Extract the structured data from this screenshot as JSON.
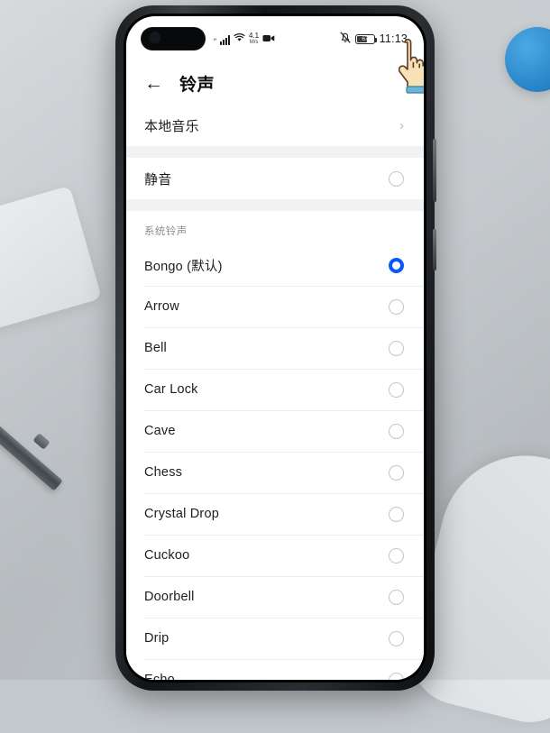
{
  "device": {
    "camera_cutout": "dual-punch-hole-camera",
    "side_buttons": [
      "volume-rocker",
      "power-button"
    ]
  },
  "statusbar": {
    "signal_prefix": "“",
    "signal_icon": "signal-bars-icon",
    "wifi_icon": "wifi-icon",
    "network_speed_value": "4.1",
    "network_speed_unit": "M/s",
    "recording_icon": "video-recording-icon",
    "mute_icon": "bell-off-icon",
    "battery_icon": "battery-icon",
    "battery_level": "67",
    "time": "11:13"
  },
  "header": {
    "back_icon": "←",
    "title": "铃声"
  },
  "list": {
    "local_group": [
      {
        "label": "本地音乐",
        "accessory": "chevron",
        "cjk": true
      }
    ],
    "silent_group": [
      {
        "label": "静音",
        "accessory": "radio",
        "selected": false,
        "cjk": true
      }
    ],
    "system_section_title": "系统铃声",
    "system_ringtones": [
      {
        "label": "Bongo (默认)",
        "selected": true
      },
      {
        "label": "Arrow",
        "selected": false
      },
      {
        "label": "Bell",
        "selected": false
      },
      {
        "label": "Car Lock",
        "selected": false
      },
      {
        "label": "Cave",
        "selected": false
      },
      {
        "label": "Chess",
        "selected": false
      },
      {
        "label": "Crystal Drop",
        "selected": false
      },
      {
        "label": "Cuckoo",
        "selected": false
      },
      {
        "label": "Doorbell",
        "selected": false
      },
      {
        "label": "Drip",
        "selected": false
      },
      {
        "label": "Echo",
        "selected": false
      }
    ]
  },
  "cursor": {
    "icon": "pointing-hand-cursor",
    "target_row": "Car Lock"
  },
  "colors": {
    "accent": "#0a59f7",
    "radio_unselected": "#c5c5c7",
    "separator": "#eceded",
    "group_gap": "#f1f2f3",
    "background": "#c3c8cc",
    "text_primary": "#1d1d1d",
    "text_secondary": "#8b8d90"
  },
  "background_objects": [
    {
      "name": "notebook",
      "color": "#eef1f3"
    },
    {
      "name": "stylus-pen",
      "color": "#4a5055"
    },
    {
      "name": "blue-object",
      "color": "#1f8ad4"
    },
    {
      "name": "white-rounded-object",
      "color": "#f2f4f6"
    }
  ]
}
